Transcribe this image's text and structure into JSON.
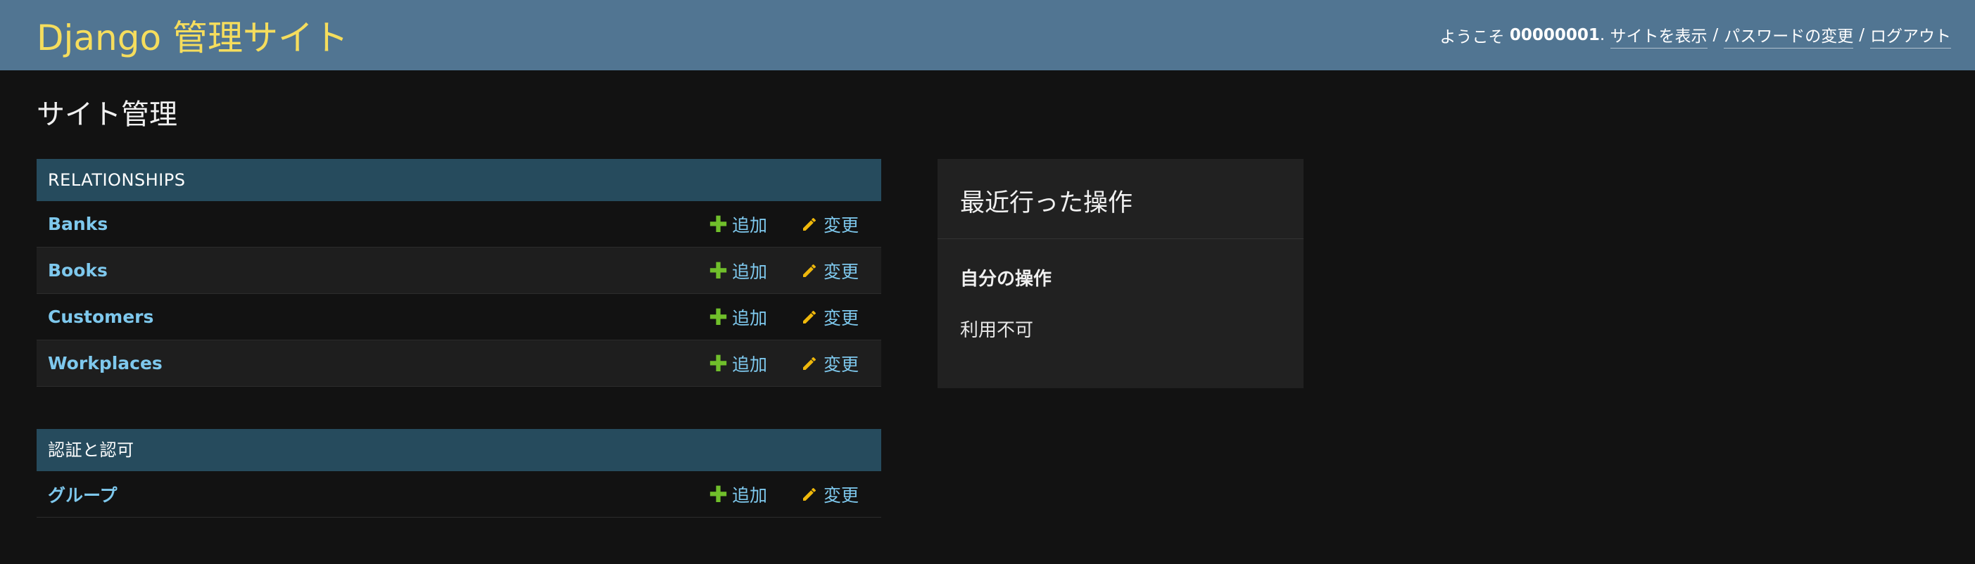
{
  "header": {
    "brand": "Django 管理サイト",
    "welcome": "ようこそ",
    "username": "00000001",
    "punct": ".",
    "view_site": "サイトを表示",
    "change_password": "パスワードの変更",
    "logout": "ログアウト",
    "separator": "/"
  },
  "page": {
    "title": "サイト管理"
  },
  "apps": [
    {
      "caption": "RELATIONSHIPS",
      "models": [
        {
          "name": "Banks",
          "add": "追加",
          "change": "変更"
        },
        {
          "name": "Books",
          "add": "追加",
          "change": "変更"
        },
        {
          "name": "Customers",
          "add": "追加",
          "change": "変更"
        },
        {
          "name": "Workplaces",
          "add": "追加",
          "change": "変更"
        }
      ]
    },
    {
      "caption": "認証と認可",
      "models": [
        {
          "name": "グループ",
          "add": "追加",
          "change": "変更"
        }
      ]
    }
  ],
  "recent_actions": {
    "title": "最近行った操作",
    "subtitle": "自分の操作",
    "empty": "利用不可"
  },
  "icons": {
    "add": "plus-icon",
    "change": "pencil-icon"
  },
  "colors": {
    "header_bg": "#517592",
    "brand": "#f5dd5d",
    "module_caption_bg": "#264b5d",
    "link": "#7ec8ed",
    "add_icon": "#70bf2b",
    "change_icon": "#efb80b",
    "page_bg": "#121212"
  }
}
